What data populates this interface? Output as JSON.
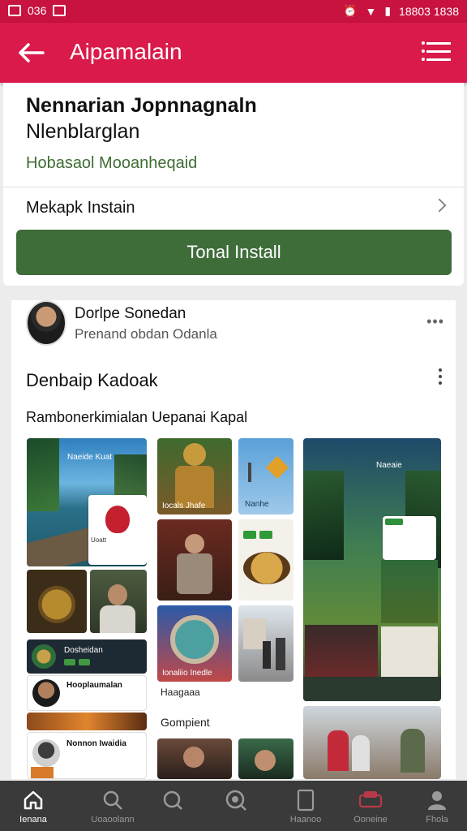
{
  "status_bar": {
    "left_text": "036",
    "right_text": "18803 1838"
  },
  "app_bar": {
    "title": "Aipamalain",
    "back_icon": "arrow-left-icon",
    "menu_icon": "list-icon"
  },
  "top_card": {
    "title": "Nennarian Jopnnagnaln",
    "subtitle": "Nlenblarglan",
    "green_text": "Hobasaol Mooanheqaid",
    "row_label": "Mekapk Instain",
    "install_button": "Tonal Install",
    "accent_color": "#3f6d3a"
  },
  "post": {
    "author": "Dorlpe Sonedan",
    "meta": "Prenand obdan Odanla",
    "heading": "Denbaip Kadoak",
    "caption": "Rambonerkimialan Uepanai Kapal",
    "tiles": {
      "t1": "Naeide Kuat",
      "t2": "Iocals Jhafe",
      "t3": "Nanhe",
      "t4": "Ionaliio Inedle",
      "t5": "Dosheidan",
      "t6": "Hooplaumalan",
      "t7": "Nonnon Iwaidia",
      "t8": "Naeaie",
      "t9": "Uoatt",
      "g_label1": "Haagaaa",
      "g_label2": "Gompient"
    }
  },
  "bottom_nav": [
    {
      "label": "Ienana",
      "icon": "home-icon",
      "active": true
    },
    {
      "label": "Uoaoolann",
      "icon": "search-icon",
      "active": false
    },
    {
      "label": "",
      "icon": "search-icon",
      "active": false
    },
    {
      "label": "",
      "icon": "search-icon",
      "active": false
    },
    {
      "label": "Haanoo",
      "icon": "document-icon",
      "active": false
    },
    {
      "label": "Ooneine",
      "icon": "car-icon",
      "active": false
    },
    {
      "label": "Fhola",
      "icon": "person-icon",
      "active": false
    }
  ]
}
